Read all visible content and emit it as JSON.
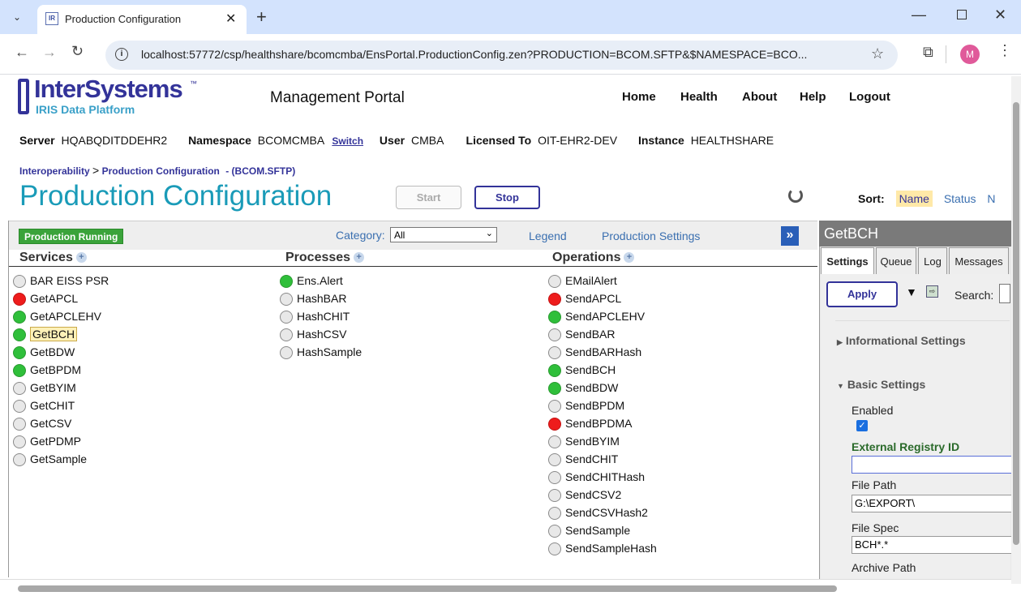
{
  "browser": {
    "tab_title": "Production Configuration",
    "tab_icon": "IR",
    "url": "localhost:57772/csp/healthshare/bcomcmba/EnsPortal.ProductionConfig.zen?PRODUCTION=BCOM.SFTP&$NAMESPACE=BCO...",
    "profile_initial": "M"
  },
  "header": {
    "logo_name": "InterSystems",
    "logo_tm": "™",
    "logo_sub": "IRIS Data Platform",
    "portal_title": "Management Portal",
    "nav": [
      "Home",
      "Health",
      "About",
      "Help",
      "Logout"
    ]
  },
  "info": {
    "server_label": "Server",
    "server": "HQABQDITDDEHR2",
    "namespace_label": "Namespace",
    "namespace": "BCOMCMBA",
    "switch": "Switch",
    "user_label": "User",
    "user": "CMBA",
    "licensed_label": "Licensed To",
    "licensed": "OIT-EHR2-DEV",
    "instance_label": "Instance",
    "instance": "HEALTHSHARE"
  },
  "breadcrumb": {
    "part1": "Interoperability",
    "sep": ">",
    "part2": "Production Configuration",
    "part3": "- (BCOM.SFTP)"
  },
  "page": {
    "title": "Production Configuration",
    "start": "Start",
    "stop": "Stop"
  },
  "sort": {
    "label": "Sort:",
    "name": "Name",
    "status": "Status",
    "next": "N"
  },
  "toolbar": {
    "running": "Production Running",
    "category_label": "Category:",
    "category_value": "All",
    "legend": "Legend",
    "prod_settings": "Production Settings",
    "collapse": "»"
  },
  "columns": {
    "services": "Services",
    "processes": "Processes",
    "operations": "Operations"
  },
  "services": [
    {
      "name": "BAR EISS PSR",
      "status": "gray"
    },
    {
      "name": "GetAPCL",
      "status": "red"
    },
    {
      "name": "GetAPCLEHV",
      "status": "green"
    },
    {
      "name": "GetBCH",
      "status": "green",
      "selected": true
    },
    {
      "name": "GetBDW",
      "status": "green"
    },
    {
      "name": "GetBPDM",
      "status": "green"
    },
    {
      "name": "GetBYIM",
      "status": "gray"
    },
    {
      "name": "GetCHIT",
      "status": "gray"
    },
    {
      "name": "GetCSV",
      "status": "gray"
    },
    {
      "name": "GetPDMP",
      "status": "gray"
    },
    {
      "name": "GetSample",
      "status": "gray"
    }
  ],
  "processes": [
    {
      "name": "Ens.Alert",
      "status": "green"
    },
    {
      "name": "HashBAR",
      "status": "gray"
    },
    {
      "name": "HashCHIT",
      "status": "gray"
    },
    {
      "name": "HashCSV",
      "status": "gray"
    },
    {
      "name": "HashSample",
      "status": "gray"
    }
  ],
  "operations": [
    {
      "name": "EMailAlert",
      "status": "gray"
    },
    {
      "name": "SendAPCL",
      "status": "red"
    },
    {
      "name": "SendAPCLEHV",
      "status": "green"
    },
    {
      "name": "SendBAR",
      "status": "gray"
    },
    {
      "name": "SendBARHash",
      "status": "gray"
    },
    {
      "name": "SendBCH",
      "status": "green"
    },
    {
      "name": "SendBDW",
      "status": "green"
    },
    {
      "name": "SendBPDM",
      "status": "gray"
    },
    {
      "name": "SendBPDMA",
      "status": "red"
    },
    {
      "name": "SendBYIM",
      "status": "gray"
    },
    {
      "name": "SendCHIT",
      "status": "gray"
    },
    {
      "name": "SendCHITHash",
      "status": "gray"
    },
    {
      "name": "SendCSV2",
      "status": "gray"
    },
    {
      "name": "SendCSVHash2",
      "status": "gray"
    },
    {
      "name": "SendSample",
      "status": "gray"
    },
    {
      "name": "SendSampleHash",
      "status": "gray"
    }
  ],
  "right_panel": {
    "title": "GetBCH",
    "tabs": [
      "Settings",
      "Queue",
      "Log",
      "Messages"
    ],
    "apply": "Apply",
    "search_label": "Search:",
    "informational": "Informational Settings",
    "basic": "Basic Settings",
    "enabled_label": "Enabled",
    "ext_reg_label": "External Registry ID",
    "ext_reg_value": "",
    "file_path_label": "File Path",
    "file_path_value": "G:\\EXPORT\\",
    "file_spec_label": "File Spec",
    "file_spec_value": "BCH*.*",
    "archive_label": "Archive Path"
  },
  "colors": {
    "accent": "#1a9bb8",
    "nav_blue": "#333399",
    "green": "#2fbf3a",
    "red": "#ee1c1c",
    "running": "#3aa33a",
    "panel_header": "#7a7a7a"
  }
}
